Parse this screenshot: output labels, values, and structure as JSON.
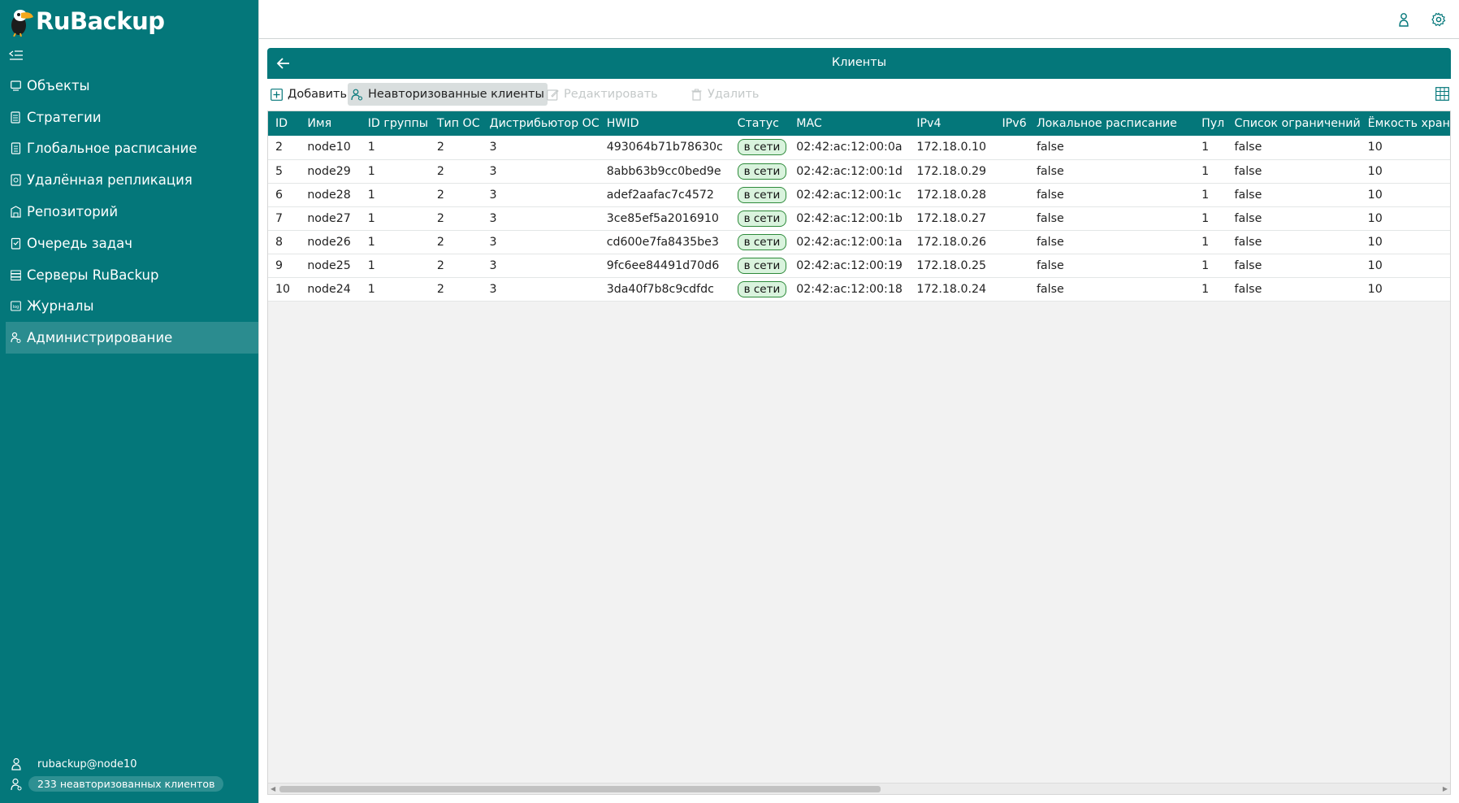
{
  "app": {
    "logo_text": "RuBackup"
  },
  "sidebar": {
    "items": [
      {
        "label": "Объекты",
        "icon": "monitor-icon"
      },
      {
        "label": "Стратегии",
        "icon": "strategy-icon"
      },
      {
        "label": "Глобальное расписание",
        "icon": "schedule-icon"
      },
      {
        "label": "Удалённая репликация",
        "icon": "replication-icon"
      },
      {
        "label": "Репозиторий",
        "icon": "repository-icon"
      },
      {
        "label": "Очередь задач",
        "icon": "task-queue-icon"
      },
      {
        "label": "Серверы RuBackup",
        "icon": "servers-icon"
      },
      {
        "label": "Журналы",
        "icon": "log-icon"
      },
      {
        "label": "Администрирование",
        "icon": "admin-icon",
        "active": true
      }
    ],
    "user": "rubackup@node10",
    "unauthorized_badge": "233 неавторизованных клиентов"
  },
  "page": {
    "title": "Клиенты"
  },
  "toolbar": {
    "add_label": "Добавить",
    "unauthorized_label": "Неавторизованные клиенты",
    "edit_label": "Редактировать",
    "delete_label": "Удалить"
  },
  "table": {
    "columns": [
      "ID",
      "Имя",
      "ID группы",
      "Тип ОС",
      "Дистрибьютор ОС",
      "HWID",
      "Статус",
      "MAC",
      "IPv4",
      "IPv6",
      "Локальное расписание",
      "Пул",
      "Список ограничений",
      "Ёмкость хран"
    ],
    "rows": [
      [
        "2",
        "node10",
        "1",
        "2",
        "3",
        "493064b71b78630c",
        "в сети",
        "02:42:ac:12:00:0a",
        "172.18.0.10",
        "",
        "false",
        "1",
        "false",
        "10"
      ],
      [
        "5",
        "node29",
        "1",
        "2",
        "3",
        "8abb63b9cc0bed9e",
        "в сети",
        "02:42:ac:12:00:1d",
        "172.18.0.29",
        "",
        "false",
        "1",
        "false",
        "10"
      ],
      [
        "6",
        "node28",
        "1",
        "2",
        "3",
        "adef2aafac7c4572",
        "в сети",
        "02:42:ac:12:00:1c",
        "172.18.0.28",
        "",
        "false",
        "1",
        "false",
        "10"
      ],
      [
        "7",
        "node27",
        "1",
        "2",
        "3",
        "3ce85ef5a2016910",
        "в сети",
        "02:42:ac:12:00:1b",
        "172.18.0.27",
        "",
        "false",
        "1",
        "false",
        "10"
      ],
      [
        "8",
        "node26",
        "1",
        "2",
        "3",
        "cd600e7fa8435be3",
        "в сети",
        "02:42:ac:12:00:1a",
        "172.18.0.26",
        "",
        "false",
        "1",
        "false",
        "10"
      ],
      [
        "9",
        "node25",
        "1",
        "2",
        "3",
        "9fc6ee84491d70d6",
        "в сети",
        "02:42:ac:12:00:19",
        "172.18.0.25",
        "",
        "false",
        "1",
        "false",
        "10"
      ],
      [
        "10",
        "node24",
        "1",
        "2",
        "3",
        "3da40f7b8c9cdfdc",
        "в сети",
        "02:42:ac:12:00:18",
        "172.18.0.24",
        "",
        "false",
        "1",
        "false",
        "10"
      ]
    ]
  },
  "colors": {
    "primary": "#04777a",
    "active_item": "#2b8c8f",
    "status_online_bg": "#d9f3dd",
    "status_online_border": "#2d8a3a"
  }
}
